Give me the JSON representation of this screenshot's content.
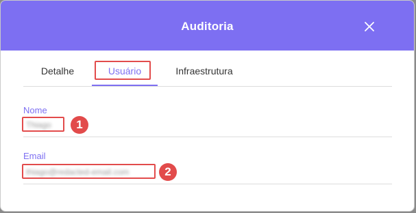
{
  "modal": {
    "title": "Auditoria",
    "close_icon": "close-icon"
  },
  "tabs": [
    {
      "label": "Detalhe",
      "active": false
    },
    {
      "label": "Usuário",
      "active": true
    },
    {
      "label": "Infraestrutura",
      "active": false
    }
  ],
  "fields": {
    "name": {
      "label": "Nome",
      "value": "Thiago"
    },
    "email": {
      "label": "Email",
      "value": "thiago@redacted-email.com"
    }
  },
  "annotations": {
    "badge_1": "1",
    "badge_2": "2"
  },
  "colors": {
    "accent": "#7d6ff2",
    "highlight": "#e24b4b"
  }
}
